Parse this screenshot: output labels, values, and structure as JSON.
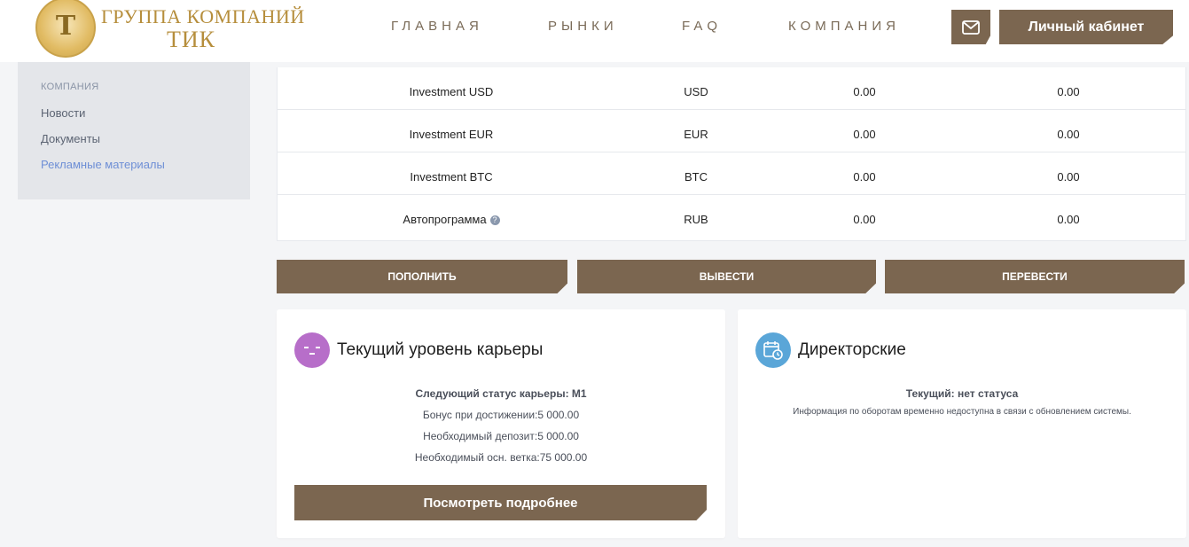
{
  "header": {
    "logo_line1": "ГРУППА КОМПАНИЙ",
    "logo_line2": "ТИК",
    "nav": [
      "ГЛАВНАЯ",
      "РЫНКИ",
      "FAQ",
      "КОМПАНИЯ"
    ],
    "cabinet_label": "Личный кабинет",
    "mail_icon": "mail-icon"
  },
  "sidebar": {
    "section_title": "КОМПАНИЯ",
    "links": [
      "Новости",
      "Документы",
      "Рекламные материалы"
    ],
    "active_link": "Рекламные материалы"
  },
  "accounts": {
    "rows": [
      {
        "name": "Investment USD",
        "currency": "USD",
        "col3": "0.00",
        "col4": "0.00"
      },
      {
        "name": "Investment EUR",
        "currency": "EUR",
        "col3": "0.00",
        "col4": "0.00"
      },
      {
        "name": "Investment BTC",
        "currency": "BTC",
        "col3": "0.00",
        "col4": "0.00"
      },
      {
        "name": "Автопрограмма",
        "currency": "RUB",
        "col3": "0.00",
        "col4": "0.00",
        "has_help_icon": true
      }
    ],
    "help_glyph": "?"
  },
  "actions": {
    "deposit": "ПОПОЛНИТЬ",
    "withdraw": "ВЫВЕСТИ",
    "transfer": "ПЕРЕВЕСТИ"
  },
  "career": {
    "title": "Текущий уровень карьеры",
    "icon": "face-icon",
    "next_status": "Следующий статус карьеры: M1",
    "bonus": "Бонус при достижении:5 000.00",
    "deposit_required": "Необходимый депозит:5 000.00",
    "branch_required": "Необходимый осн. ветка:75 000.00",
    "more_button": "Посмотреть подробнее"
  },
  "directors": {
    "title": "Директорские",
    "icon": "calendar-icon",
    "current": "Текущий: нет статуса",
    "info": "Информация по оборотам временно недоступна в связи с обновлением системы."
  },
  "colors": {
    "brand_brown": "#7b6650",
    "logo_gold": "#b68e3c",
    "accent_link": "#6e8fd6",
    "face_icon_bg": "#b76ec9",
    "calendar_icon_bg": "#5aa6d8"
  }
}
